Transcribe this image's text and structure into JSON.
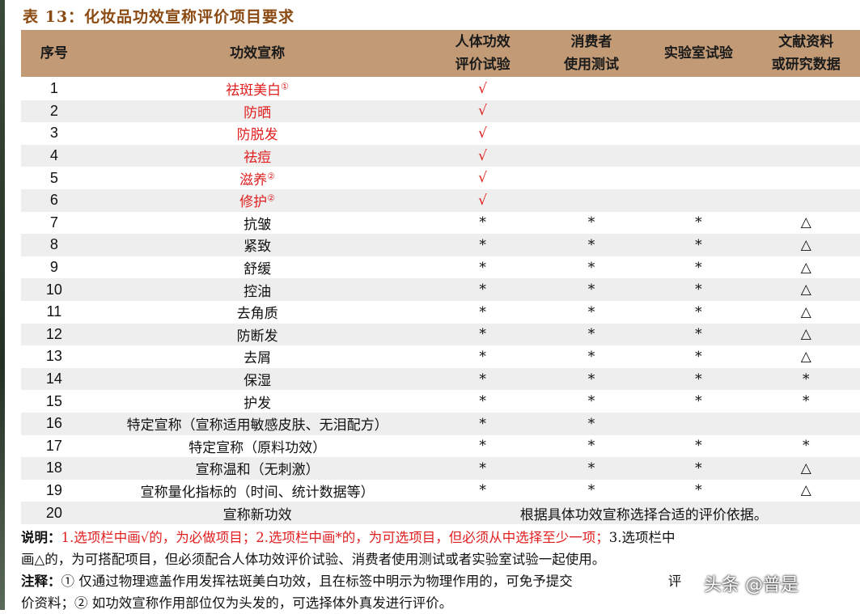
{
  "title": "表 13：化妆品功效宣称评价项目要求",
  "columns": {
    "no": "序号",
    "claim": "功效宣称",
    "human_line1": "人体功效",
    "human_line2": "评价试验",
    "consumer_line1": "消费者",
    "consumer_line2": "使用测试",
    "lab": "实验室试验",
    "literature_line1": "文献资料",
    "literature_line2": "或研究数据"
  },
  "rows": [
    {
      "no": "1",
      "claim": "祛斑美白",
      "sup": "①",
      "red": true,
      "human": "√",
      "consumer": "",
      "lab": "",
      "lit": ""
    },
    {
      "no": "2",
      "claim": "防晒",
      "sup": "",
      "red": true,
      "human": "√",
      "consumer": "",
      "lab": "",
      "lit": ""
    },
    {
      "no": "3",
      "claim": "防脱发",
      "sup": "",
      "red": true,
      "human": "√",
      "consumer": "",
      "lab": "",
      "lit": ""
    },
    {
      "no": "4",
      "claim": "祛痘",
      "sup": "",
      "red": true,
      "human": "√",
      "consumer": "",
      "lab": "",
      "lit": ""
    },
    {
      "no": "5",
      "claim": "滋养",
      "sup": "②",
      "red": true,
      "human": "√",
      "consumer": "",
      "lab": "",
      "lit": ""
    },
    {
      "no": "6",
      "claim": "修护",
      "sup": "②",
      "red": true,
      "human": "√",
      "consumer": "",
      "lab": "",
      "lit": ""
    },
    {
      "no": "7",
      "claim": "抗皱",
      "sup": "",
      "red": false,
      "human": "*",
      "consumer": "*",
      "lab": "*",
      "lit": "△"
    },
    {
      "no": "8",
      "claim": "紧致",
      "sup": "",
      "red": false,
      "human": "*",
      "consumer": "*",
      "lab": "*",
      "lit": "△"
    },
    {
      "no": "9",
      "claim": "舒缓",
      "sup": "",
      "red": false,
      "human": "*",
      "consumer": "*",
      "lab": "*",
      "lit": "△"
    },
    {
      "no": "10",
      "claim": "控油",
      "sup": "",
      "red": false,
      "human": "*",
      "consumer": "*",
      "lab": "*",
      "lit": "△"
    },
    {
      "no": "11",
      "claim": "去角质",
      "sup": "",
      "red": false,
      "human": "*",
      "consumer": "*",
      "lab": "*",
      "lit": "△"
    },
    {
      "no": "12",
      "claim": "防断发",
      "sup": "",
      "red": false,
      "human": "*",
      "consumer": "*",
      "lab": "*",
      "lit": "△"
    },
    {
      "no": "13",
      "claim": "去屑",
      "sup": "",
      "red": false,
      "human": "*",
      "consumer": "*",
      "lab": "*",
      "lit": "△"
    },
    {
      "no": "14",
      "claim": "保湿",
      "sup": "",
      "red": false,
      "human": "*",
      "consumer": "*",
      "lab": "*",
      "lit": "*"
    },
    {
      "no": "15",
      "claim": "护发",
      "sup": "",
      "red": false,
      "human": "*",
      "consumer": "*",
      "lab": "*",
      "lit": "*"
    },
    {
      "no": "16",
      "claim": "特定宣称（宣称适用敏感皮肤、无泪配方）",
      "sup": "",
      "red": false,
      "human": "*",
      "consumer": "*",
      "lab": "",
      "lit": ""
    },
    {
      "no": "17",
      "claim": "特定宣称（原料功效）",
      "sup": "",
      "red": false,
      "human": "*",
      "consumer": "*",
      "lab": "*",
      "lit": "*"
    },
    {
      "no": "18",
      "claim": "宣称温和（无刺激）",
      "sup": "",
      "red": false,
      "human": "*",
      "consumer": "*",
      "lab": "*",
      "lit": "△"
    },
    {
      "no": "19",
      "claim": "宣称量化指标的（时间、统计数据等）",
      "sup": "",
      "red": false,
      "human": "*",
      "consumer": "*",
      "lab": "*",
      "lit": "△"
    }
  ],
  "last_row": {
    "no": "20",
    "claim": "宣称新功效",
    "span_text": "根据具体功效宣称选择合适的评价依据。"
  },
  "notes": {
    "label": "说明：",
    "red_part": "1.选项栏中画√的，为必做项目；2.选项栏中画*的，为可选项目，但必须从中选择至少一项；",
    "black_part": "3.选项栏中",
    "line2": "画△的，为可搭配项目，但必须配合人体功效评价试验、消费者使用测试或者实验室试验一起使用。",
    "remark_label": "注释：",
    "remark_line1": "① 仅通过物理遮盖作用发挥祛斑美白功效，且在标签中明示为物理作用的，可免予提交",
    "remark_line1_tail": "评",
    "remark_line2": "价资料；② 如功效宣称作用部位仅为头发的，可选择体外真发进行评价。"
  },
  "watermark": "头条 @普是"
}
